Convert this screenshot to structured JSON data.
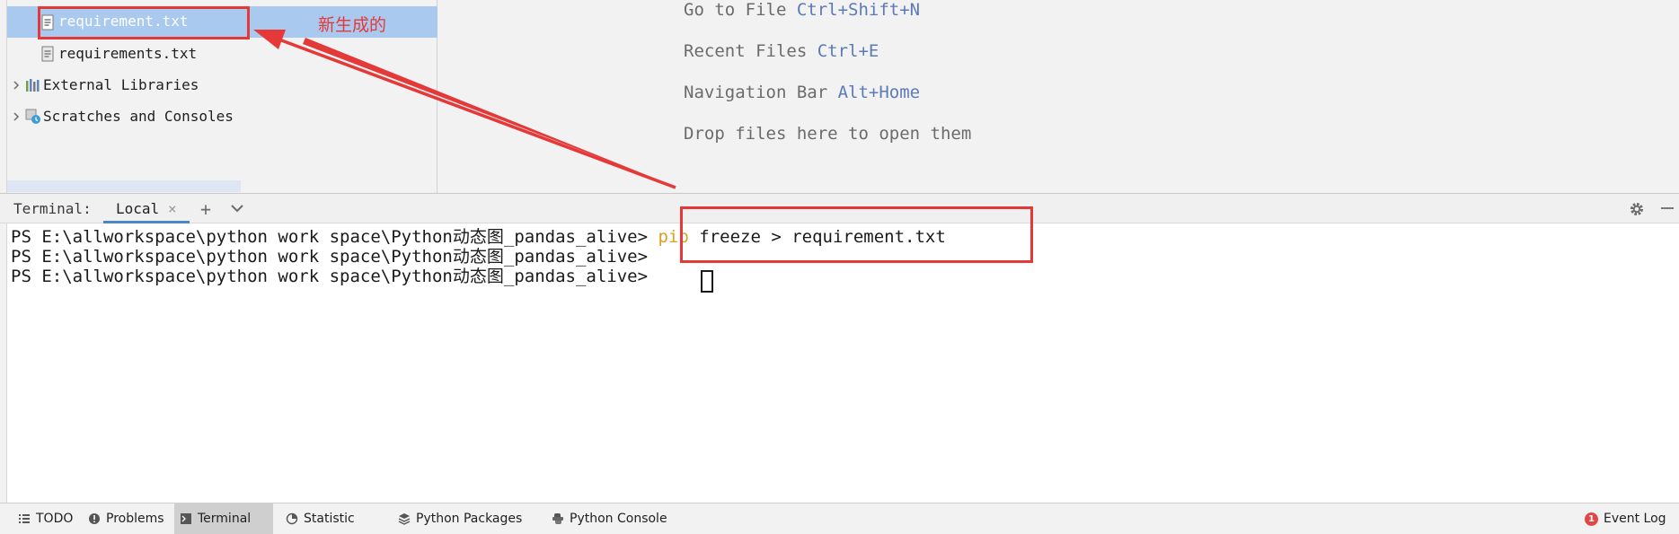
{
  "project_tree": {
    "items": [
      {
        "label": "requirement.txt",
        "selected": true
      },
      {
        "label": "requirements.txt",
        "selected": false
      },
      {
        "label": "External Libraries",
        "selected": false
      },
      {
        "label": "Scratches and Consoles",
        "selected": false
      }
    ]
  },
  "editor_hints": [
    {
      "text": "Go to File",
      "key": "Ctrl+Shift+N"
    },
    {
      "text": "Recent Files",
      "key": "Ctrl+E"
    },
    {
      "text": "Navigation Bar",
      "key": "Alt+Home"
    },
    {
      "text": "Drop files here to open them",
      "key": ""
    }
  ],
  "terminal": {
    "title": "Terminal:",
    "tab_label": "Local",
    "prompt": "PS E:\\allworkspace\\python work space\\Python动态图_pandas_alive>",
    "lines": [
      {
        "cmd_name": "pip",
        "cmd_args": "freeze > requirement.txt"
      },
      {
        "cmd_name": "",
        "cmd_args": ""
      },
      {
        "cmd_name": "",
        "cmd_args": ""
      }
    ]
  },
  "annotation": {
    "label": "新生成的",
    "color": "#e53939"
  },
  "status_bar": {
    "items": [
      "TODO",
      "Problems",
      "Terminal",
      "Statistic",
      "Python Packages",
      "Python Console"
    ],
    "active": "Terminal",
    "event_log": "Event Log",
    "event_count": "1"
  },
  "colors": {
    "selection": "#a9c9ef",
    "shortcut": "#5c79b8",
    "command": "#d6a31e",
    "tab_underline": "#4a88c7"
  }
}
